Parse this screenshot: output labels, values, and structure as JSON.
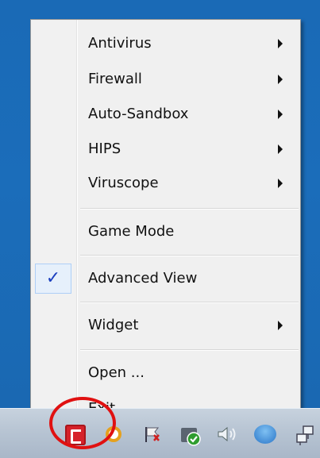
{
  "menu": {
    "items": [
      {
        "label": "Antivirus",
        "submenu": true
      },
      {
        "label": "Firewall",
        "submenu": true
      },
      {
        "label": "Auto-Sandbox",
        "submenu": true
      },
      {
        "label": "HIPS",
        "submenu": true
      },
      {
        "label": "Viruscope",
        "submenu": true
      },
      {
        "label": "Game Mode",
        "submenu": false
      },
      {
        "label": "Advanced View",
        "submenu": false,
        "checked": true
      },
      {
        "label": "Widget",
        "submenu": true
      },
      {
        "label": "Open ...",
        "submenu": false
      },
      {
        "label": "Exit",
        "submenu": false
      }
    ],
    "check_glyph": "✓"
  },
  "taskbar": {
    "icons": [
      "comodo-app-icon",
      "gear-icon",
      "flag-icon",
      "shield-check-icon",
      "speaker-icon",
      "cloud-icon",
      "network-icon"
    ]
  },
  "colors": {
    "desktop": "#1b6dba",
    "menu_bg": "#f0f0f0",
    "check": "#1b3fbf",
    "highlight_ring": "#e01111"
  }
}
